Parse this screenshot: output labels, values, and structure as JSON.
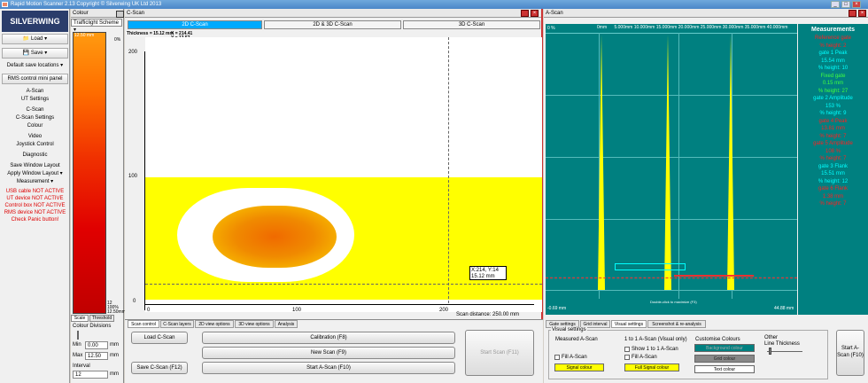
{
  "titlebar": {
    "title": "Rapid Motion Scanner 2.13     Copyright © Silverwing UK Ltd 2013"
  },
  "sidebar": {
    "logo": "SILVERWING",
    "load": "Load",
    "save": "Save",
    "default_save": "Default save locations",
    "rms_control": "RMS control mini panel",
    "items": [
      "A-Scan",
      "UT Settings",
      "C-Scan",
      "C-Scan Settings",
      "Colour",
      "Video",
      "Joystick Control",
      "Diagnostic",
      "Save Window Layout",
      "Apply Window Layout",
      "Measurement"
    ],
    "warnings": [
      "USB cable NOT ACTIVE",
      "UT device NOT ACTIVE",
      "Control box NOT ACTIVE",
      "RMS device NOT ACTIVE",
      "Check Panic button!"
    ]
  },
  "colour_panel": {
    "title": "Colour",
    "scheme": "Trafficlight Scheme",
    "scale_top": "12.50 mm",
    "scale_top_pct": "0%",
    "scale_bottom": "12",
    "scale_bottom_pct": "100%",
    "scale_bottom_mm": "12.50mm",
    "tabs": [
      "Scale",
      "Threshold"
    ],
    "divisions_label": "Colour Divisions",
    "min_label": "Min",
    "min_value": "0.00",
    "max_label": "Max",
    "max_value": "12.50",
    "unit": "mm",
    "interval_label": "Interval",
    "interval_value": "12"
  },
  "cscan": {
    "title": "C-Scan",
    "tabs": [
      "2D C-Scan",
      "2D & 3D C-Scan",
      "3D C-Scan"
    ],
    "thickness": "Thickness = 15.12 mm",
    "coord_x": "X = 214.41",
    "coord_y": "Y = 13.57",
    "y_ticks": [
      "200",
      "100",
      "0"
    ],
    "x_ticks": [
      "0",
      "100",
      "200"
    ],
    "cursor_label_1": "X:214, Y:14",
    "cursor_label_2": "15.12 mm",
    "scan_distance": "Scan distance: 250.00 mm",
    "bottom_tabs": [
      "Scan control",
      "C-Scan layers",
      "2D view options",
      "3D view options",
      "Analysis"
    ],
    "buttons": {
      "load": "Load C-Scan",
      "save": "Save C-Scan (F12)",
      "calibration": "Calibration (F8)",
      "new_scan": "New Scan (F9)",
      "start_ascan": "Start A-Scan (F10)",
      "start_scan": "Start Scan (F11)"
    }
  },
  "ascan": {
    "title": "A-Scan",
    "top_label": "0 %",
    "mm_ticks": [
      "0mm",
      "5.000mm",
      "10.000mm",
      "15.000mm",
      "20.000mm",
      "25.000mm",
      "30.000mm",
      "35.000mm",
      "40.000mm"
    ],
    "left_value": "-0.69 mm",
    "right_value": "44.88 mm",
    "double_click": "Double-click to maximize (F3)",
    "measurements_title": "Measurements",
    "measurements": [
      {
        "text": "Reference gate",
        "color": "#ff2020"
      },
      {
        "text": "% height: 2",
        "color": "#ff2020"
      },
      {
        "text": "gate 1 Peak",
        "color": "#00ffff"
      },
      {
        "text": "15.54 mm",
        "color": "#00ffff"
      },
      {
        "text": "% height: 10",
        "color": "#00ffff"
      },
      {
        "text": "Fixed gate",
        "color": "#40ff40"
      },
      {
        "text": "0.15 mm",
        "color": "#40ff40"
      },
      {
        "text": "% height: 27",
        "color": "#40ff40"
      },
      {
        "text": "gate 2 Amplitude",
        "color": "#00ffff"
      },
      {
        "text": "153 %",
        "color": "#00ffff"
      },
      {
        "text": "% height: 9",
        "color": "#00ffff"
      },
      {
        "text": "gate 4 Peak",
        "color": "#ff2020"
      },
      {
        "text": "13.81 mm",
        "color": "#ff2020"
      },
      {
        "text": "% height: 7",
        "color": "#ff2020"
      },
      {
        "text": "gate 5 Amplitude",
        "color": "#ff2020"
      },
      {
        "text": "108 %",
        "color": "#ff2020"
      },
      {
        "text": "% height: 7",
        "color": "#ff2020"
      },
      {
        "text": "gate 3 Flank",
        "color": "#00ffff"
      },
      {
        "text": "15.51 mm",
        "color": "#00ffff"
      },
      {
        "text": "% height: 12",
        "color": "#00ffff"
      },
      {
        "text": "gate 6 Flank",
        "color": "#ff2020"
      },
      {
        "text": "1.38 mm",
        "color": "#ff2020"
      },
      {
        "text": "% height: 7",
        "color": "#ff2020"
      }
    ],
    "bottom_tabs": [
      "Gate settings",
      "Grid interval",
      "Visual settings",
      "Screenshot & re-analysis"
    ],
    "visual_settings": "Visual settings",
    "measured_ascan": "Measured A-Scan",
    "fill_ascan": "Fill A-Scan",
    "signal_colour": "Signal colour",
    "one_to_one": "1 to 1 A-Scan (Visual only)",
    "show_one_to_one": "Show 1 to 1 A-Scan",
    "fill_ascan_2": "Fill A-Scan",
    "full_signal_colour": "Full Signal colour",
    "customise_colours": "Customise Colours",
    "background_colour": "Background colour",
    "grid_colour": "Grid colour",
    "text_colour": "Text colour",
    "other": "Other",
    "line_thickness": "Line Thickness",
    "start_ascan": "Start A-Scan (F10)"
  },
  "colors": {
    "accent_teal": "#008080",
    "signal_yellow": "#ffff00",
    "warning_red": "#dd0000"
  }
}
